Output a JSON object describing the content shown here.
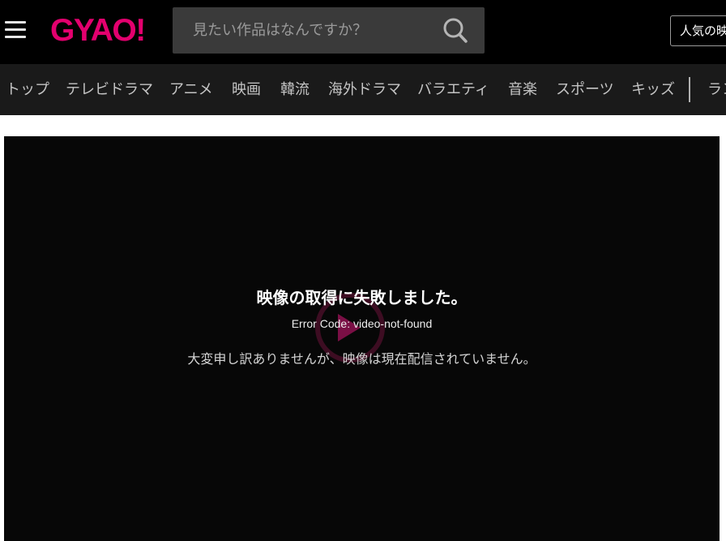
{
  "header": {
    "logo_text": "GYAO!",
    "search": {
      "placeholder": "見たい作品はなんですか？",
      "value": ""
    },
    "popular_button": "人気の映"
  },
  "nav": {
    "items": [
      "トップ",
      "テレビドラマ",
      "アニメ",
      "映画",
      "韓流",
      "海外ドラマ",
      "バラエティ",
      "音楽",
      "スポーツ",
      "キッズ",
      "ラン"
    ]
  },
  "player": {
    "error_title": "映像の取得に失敗しました。",
    "error_code": "Error Code: video-not-found",
    "error_message": "大変申し訳ありませんが、映像は現在配信されていません。"
  },
  "colors": {
    "brand": "#e3006e",
    "header_bg": "#000000",
    "nav_bg": "#1a1a1a",
    "player_bg": "#070707"
  },
  "icons": {
    "menu": "hamburger-icon",
    "search": "search-icon",
    "play": "play-icon"
  }
}
